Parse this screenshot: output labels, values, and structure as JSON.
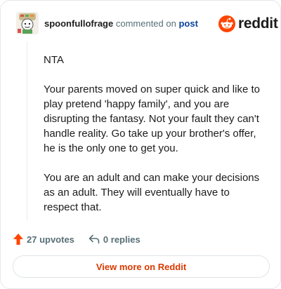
{
  "comment": {
    "username": "spoonfullofrage",
    "commented_on_text": "commented on",
    "post_link_text": "post",
    "brand": "reddit",
    "paragraphs": [
      "NTA",
      "Your parents moved on super quick and like to play pretend 'happy family', and you are disrupting the fantasy. Not your fault they can't handle reality. Go take up your brother's offer, he is the only one to get you.",
      "You are an adult and can make your decisions as an adult. They will eventually have to respect that."
    ],
    "upvotes_label": "27 upvotes",
    "replies_label": "0 replies",
    "view_more_label": "View more on Reddit"
  },
  "icons": {
    "avatar": "avatar-image",
    "upvote": "upvote-arrow-icon",
    "reply": "reply-arrow-icon",
    "logo": "reddit-snoo-icon"
  },
  "colors": {
    "brand_orange": "#ff4500",
    "link_blue": "#0a449b",
    "cta_orange": "#d93900",
    "muted": "#576f76"
  }
}
